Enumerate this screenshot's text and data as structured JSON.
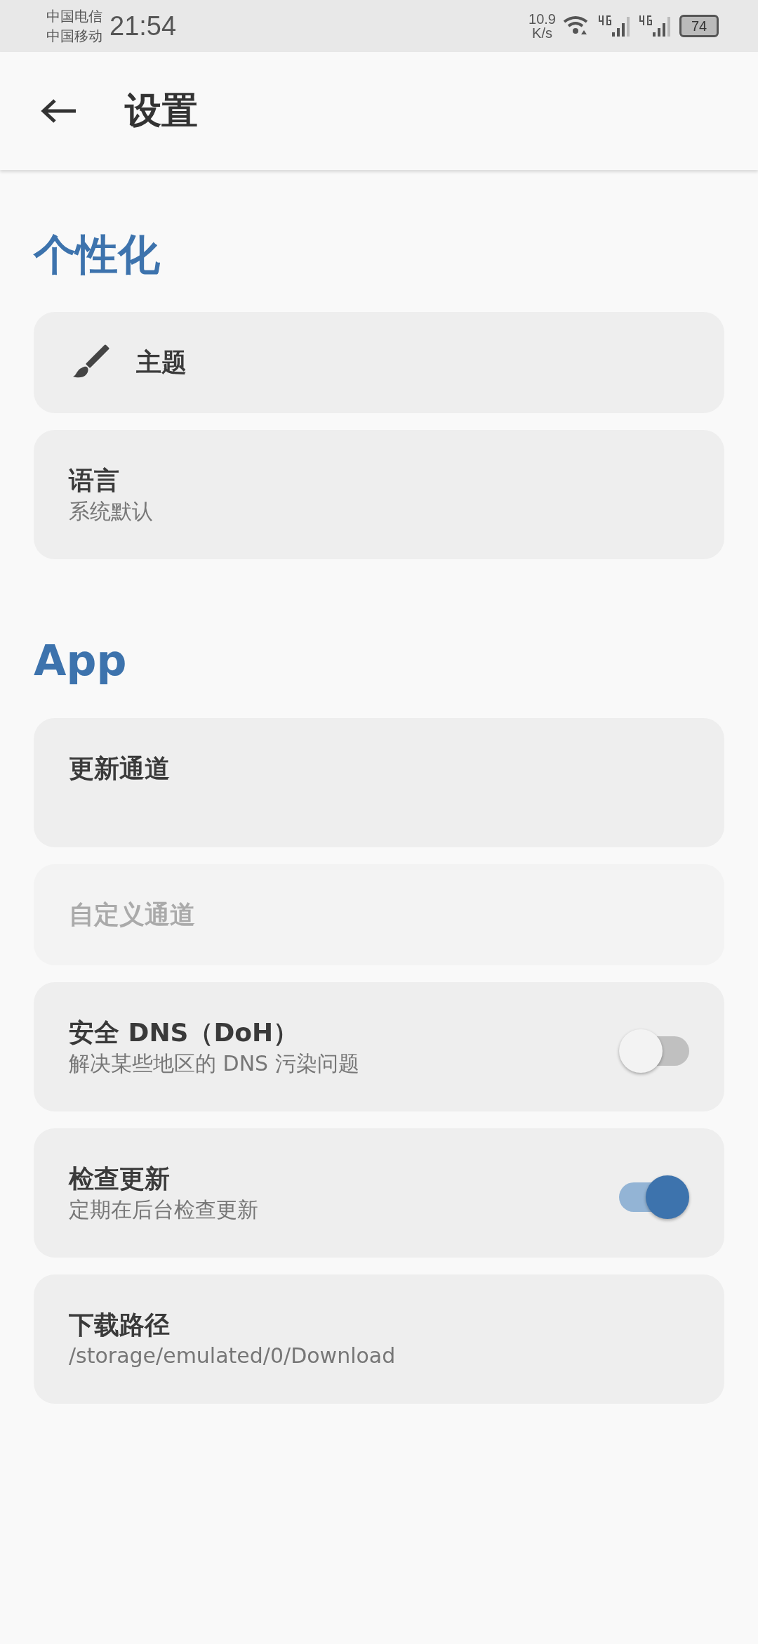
{
  "status_bar": {
    "carriers": [
      "中国电信",
      "中国移动"
    ],
    "time": "21:54",
    "speed": [
      "10.9",
      "K/s"
    ],
    "battery": "74"
  },
  "app_bar": {
    "title": "设置"
  },
  "sections": [
    {
      "title": "个性化",
      "items": [
        {
          "kind": "icon",
          "title": "主题",
          "disabled": false
        },
        {
          "kind": "text",
          "title": "语言",
          "subtitle": "系统默认",
          "disabled": false
        }
      ]
    },
    {
      "title": "App",
      "items": [
        {
          "kind": "text",
          "title": "更新通道",
          "disabled": false
        },
        {
          "kind": "text",
          "title": "自定义通道",
          "disabled": true
        },
        {
          "kind": "switch",
          "title": "安全 DNS（DoH）",
          "subtitle": "解决某些地区的 DNS 污染问题",
          "on": false,
          "disabled": false
        },
        {
          "kind": "switch",
          "title": "检查更新",
          "subtitle": "定期在后台检查更新",
          "on": true,
          "disabled": false
        },
        {
          "kind": "text",
          "title": "下载路径",
          "subtitle": "/storage/emulated/0/Download",
          "disabled": false
        }
      ]
    }
  ]
}
